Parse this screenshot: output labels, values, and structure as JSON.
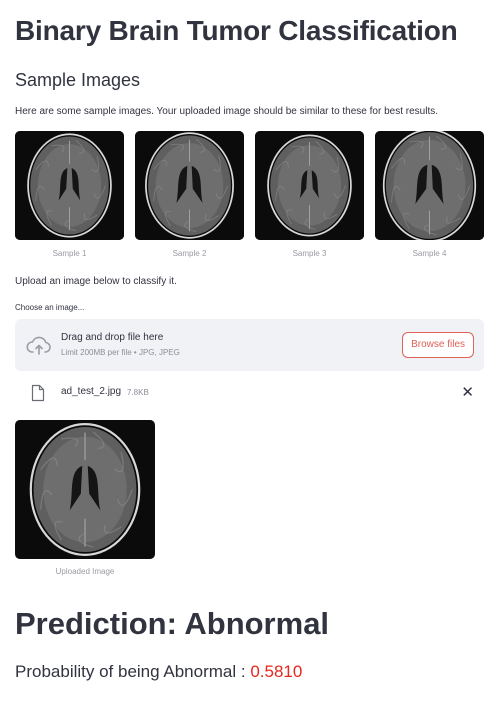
{
  "app": {
    "title": "Binary Brain Tumor Classification"
  },
  "samples": {
    "heading": "Sample Images",
    "intro": "Here are some sample images. Your uploaded image should be similar to these for best results.",
    "items": [
      {
        "caption": "Sample 1"
      },
      {
        "caption": "Sample 2"
      },
      {
        "caption": "Sample 3"
      },
      {
        "caption": "Sample 4"
      }
    ]
  },
  "upload": {
    "prompt": "Upload an image below to classify it.",
    "label": "Choose an image...",
    "drag_text": "Drag and drop file here",
    "limit_text": "Limit 200MB per file • JPG, JPEG",
    "browse_label": "Browse files",
    "file": {
      "name": "ad_test_2.jpg",
      "size": "7.8KB"
    },
    "close_symbol": "✕",
    "image_caption": "Uploaded Image"
  },
  "result": {
    "prediction": "Prediction: Abnormal",
    "probability_label": "Probability of being Abnormal : ",
    "probability_value": "0.5810"
  },
  "colors": {
    "accent": "#e0605a",
    "probability": "#e8271c",
    "dropzone_bg": "#f0f2f6"
  },
  "icons": {
    "upload": "cloud-upload-icon",
    "file": "file-icon",
    "close": "close-icon"
  }
}
